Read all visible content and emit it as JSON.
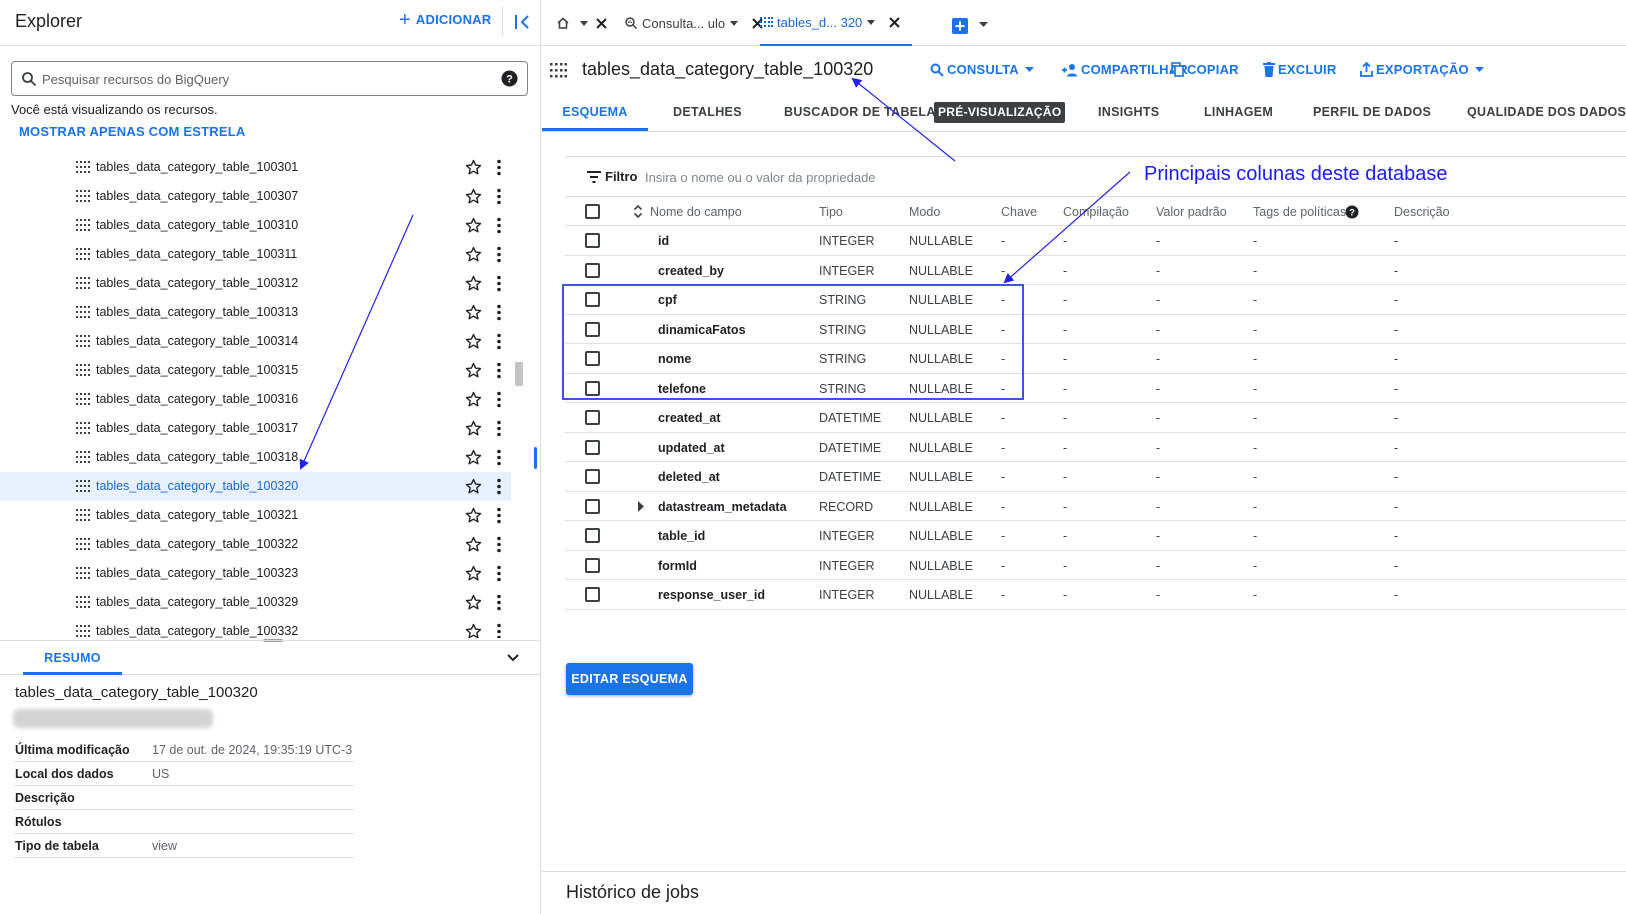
{
  "explorer": {
    "title": "Explorer",
    "add_label": "ADICIONAR",
    "search_placeholder": "Pesquisar recursos do BigQuery",
    "viewing_text": "Você está visualizando os recursos.",
    "starred_link": "MOSTRAR APENAS COM ESTRELA",
    "tree_items": [
      "tables_data_category_table_100301",
      "tables_data_category_table_100307",
      "tables_data_category_table_100310",
      "tables_data_category_table_100311",
      "tables_data_category_table_100312",
      "tables_data_category_table_100313",
      "tables_data_category_table_100314",
      "tables_data_category_table_100315",
      "tables_data_category_table_100316",
      "tables_data_category_table_100317",
      "tables_data_category_table_100318",
      "tables_data_category_table_100320",
      "tables_data_category_table_100321",
      "tables_data_category_table_100322",
      "tables_data_category_table_100323",
      "tables_data_category_table_100329",
      "tables_data_category_table_100332"
    ],
    "selected_item": "tables_data_category_table_100320"
  },
  "summary": {
    "tab_label": "RESUMO",
    "title": "tables_data_category_table_100320",
    "details": [
      {
        "key": "Última modificação",
        "value": "17 de out. de 2024, 19:35:19 UTC-3"
      },
      {
        "key": "Local dos dados",
        "value": "US"
      },
      {
        "key": "Descrição",
        "value": ""
      },
      {
        "key": "Rótulos",
        "value": ""
      },
      {
        "key": "Tipo de tabela",
        "value": "view"
      }
    ]
  },
  "tabs": [
    {
      "label": "",
      "icon": "home-icon"
    },
    {
      "label": "Consulta... ulo",
      "icon": "query-icon"
    },
    {
      "label": "tables_d... 320",
      "icon": "table-grid-icon",
      "active": true
    }
  ],
  "table": {
    "title": "tables_data_category_table_100320",
    "actions": [
      {
        "label": "CONSULTA",
        "icon": "search-icon"
      },
      {
        "label": "COMPARTILHAR",
        "icon": "person-add-icon"
      },
      {
        "label": "COPIAR",
        "icon": "copy-icon"
      },
      {
        "label": "EXCLUIR",
        "icon": "trash-icon"
      },
      {
        "label": "EXPORTAÇÃO",
        "icon": "export-icon"
      }
    ],
    "subtabs": [
      "ESQUEMA",
      "DETALHES",
      "BUSCADOR DE TABELAS",
      "INSIGHTS",
      "LINHAGEM",
      "PERFIL DE DADOS",
      "QUALIDADE DOS DADOS"
    ],
    "preview_badge": "PRÉ-VISUALIZAÇÃO"
  },
  "schema": {
    "filter_label": "Filtro",
    "filter_placeholder": "Insira o nome ou o valor da propriedade",
    "columns": [
      "Nome do campo",
      "Tipo",
      "Modo",
      "Chave",
      "Compilação",
      "Valor padrão",
      "Tags de políticas",
      "Descrição"
    ],
    "rows": [
      {
        "name": "id",
        "type": "INTEGER",
        "mode": "NULLABLE"
      },
      {
        "name": "created_by",
        "type": "INTEGER",
        "mode": "NULLABLE"
      },
      {
        "name": "cpf",
        "type": "STRING",
        "mode": "NULLABLE"
      },
      {
        "name": "dinamicaFatos",
        "type": "STRING",
        "mode": "NULLABLE"
      },
      {
        "name": "nome",
        "type": "STRING",
        "mode": "NULLABLE"
      },
      {
        "name": "telefone",
        "type": "STRING",
        "mode": "NULLABLE"
      },
      {
        "name": "created_at",
        "type": "DATETIME",
        "mode": "NULLABLE"
      },
      {
        "name": "updated_at",
        "type": "DATETIME",
        "mode": "NULLABLE"
      },
      {
        "name": "deleted_at",
        "type": "DATETIME",
        "mode": "NULLABLE"
      },
      {
        "name": "datastream_metadata",
        "type": "RECORD",
        "mode": "NULLABLE",
        "expandable": true
      },
      {
        "name": "table_id",
        "type": "INTEGER",
        "mode": "NULLABLE"
      },
      {
        "name": "formId",
        "type": "INTEGER",
        "mode": "NULLABLE"
      },
      {
        "name": "response_user_id",
        "type": "INTEGER",
        "mode": "NULLABLE"
      }
    ],
    "empty_value": "-",
    "edit_button": "EDITAR ESQUEMA"
  },
  "jobs_history": {
    "title": "Histórico de jobs"
  },
  "annotation": {
    "text": "Principais colunas deste database"
  },
  "colors": {
    "accent": "#1a73e8",
    "annotation": "#1a1aff",
    "selected_bg": "#e8f0fe"
  }
}
